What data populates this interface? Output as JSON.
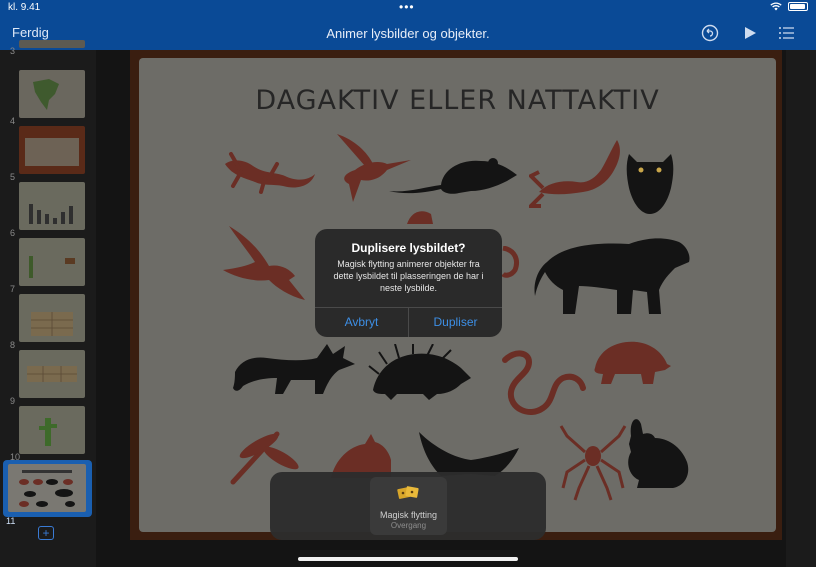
{
  "status": {
    "time": "kl. 9.41",
    "dots": "•••"
  },
  "nav": {
    "done": "Ferdig",
    "title": "Animer lysbilder og objekter."
  },
  "sidebar": {
    "thumbnails": [
      {
        "num": "3"
      },
      {
        "num": "4"
      },
      {
        "num": "5"
      },
      {
        "num": "6"
      },
      {
        "num": "7"
      },
      {
        "num": "8"
      },
      {
        "num": "9"
      },
      {
        "num": "10"
      },
      {
        "num": "11"
      }
    ],
    "add_label": "+"
  },
  "slide": {
    "title": "DAGAKTIV ELLER NATTAKTIV"
  },
  "dialog": {
    "title": "Duplisere lysbildet?",
    "message": "Magisk flytting animerer objekter fra dette lysbildet til plasseringen de har i neste lysbilde.",
    "cancel": "Avbryt",
    "confirm": "Dupliser"
  },
  "transition": {
    "name": "Magisk flytting",
    "category": "Overgang"
  },
  "colors": {
    "nav": "#0a4a96",
    "accent": "#3d8fe6",
    "animal_red": "#6b2e25",
    "animal_black": "#141414"
  }
}
